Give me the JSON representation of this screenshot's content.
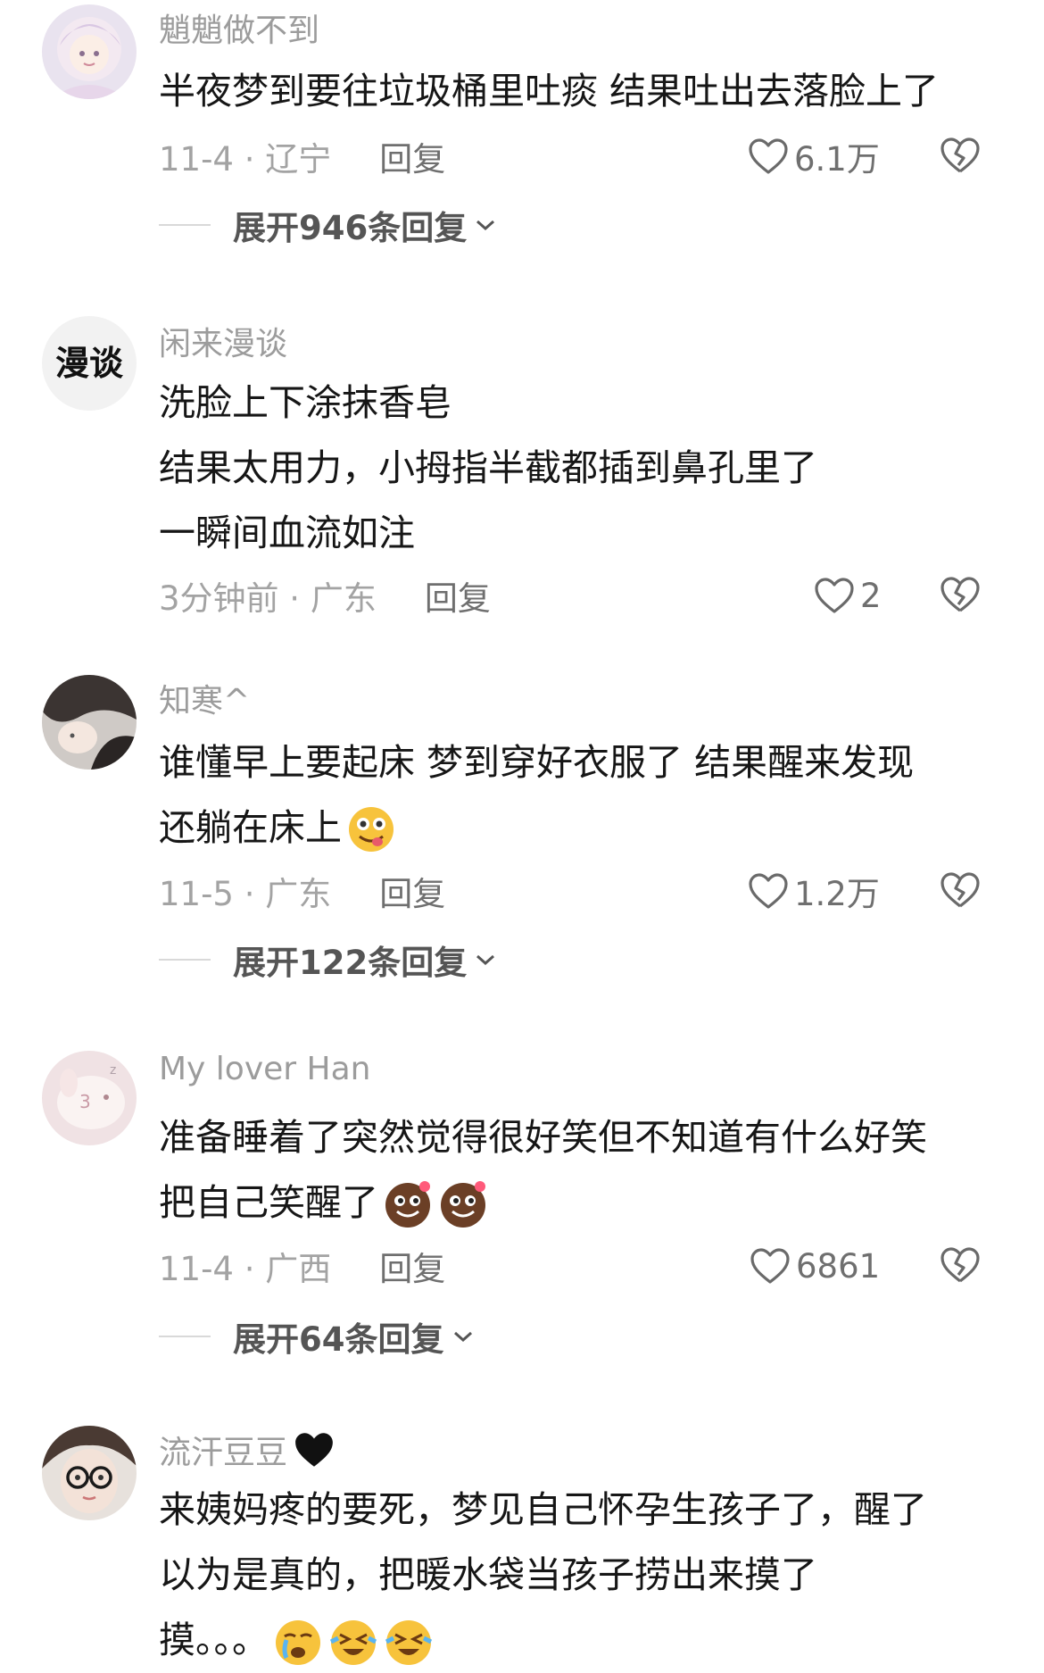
{
  "comments": [
    {
      "username": "魈魈做不到",
      "lines": [
        "半夜梦到要往垃圾桶里吐痰 结果吐出去落脸上了"
      ],
      "date_location": "11-4 · 辽宁",
      "reply_label": "回复",
      "likes": "6.1万",
      "expand_label": "展开946条回复"
    },
    {
      "username": "闲来漫谈",
      "avatar_text": "漫谈",
      "lines": [
        "洗脸上下涂抹香皂",
        "结果太用力，小拇指半截都插到鼻孔里了",
        "一瞬间血流如注"
      ],
      "date_location": "3分钟前 · 广东",
      "reply_label": "回复",
      "likes": "2"
    },
    {
      "username": "知寒^",
      "lines": [
        "谁懂早上要起床 梦到穿好衣服了 结果醒来发现",
        "还躺在床上"
      ],
      "emoji": [
        "drooling-face"
      ],
      "date_location": "11-5 · 广东",
      "reply_label": "回复",
      "likes": "1.2万",
      "expand_label": "展开122条回复"
    },
    {
      "username": "My lover Han",
      "lines": [
        "准备睡着了突然觉得很好笑但不知道有什么好笑",
        "把自己笑醒了"
      ],
      "emoji": [
        "brown-laughing-face",
        "brown-laughing-face"
      ],
      "date_location": "11-4 · 广西",
      "reply_label": "回复",
      "likes": "6861",
      "expand_label": "展开64条回复"
    },
    {
      "username": "流汗豆豆",
      "username_emoji": "black-heart",
      "lines": [
        "来姨妈疼的要死，梦见自己怀孕生孩子了，醒了",
        "以为是真的，把暖水袋当孩子捞出来摸了",
        "摸。。。"
      ],
      "emoji": [
        "crying-face",
        "laughing-rolling-face",
        "laughing-rolling-face"
      ]
    }
  ],
  "colors": {
    "username": "#9c9c9c",
    "content": "#161616",
    "meta": "#a3a3a3",
    "action": "#6f6f6f"
  }
}
